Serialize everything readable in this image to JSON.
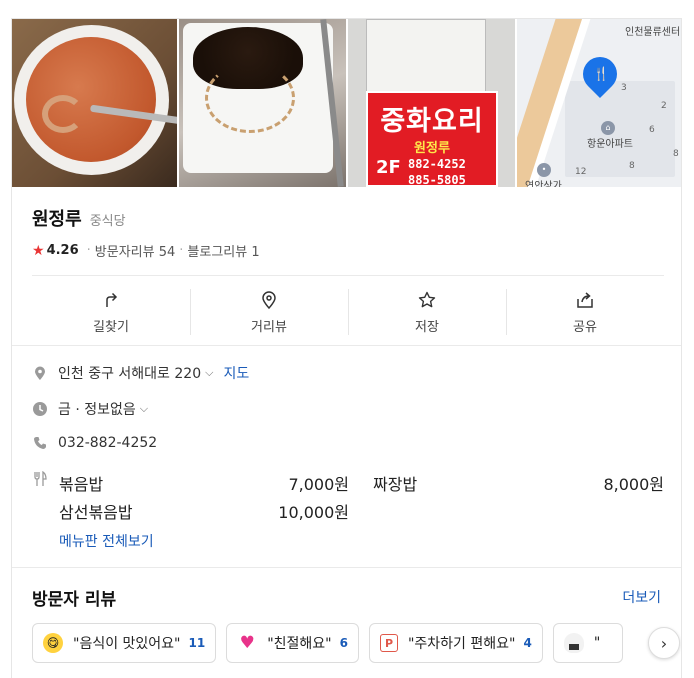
{
  "place": {
    "name": "원정루",
    "category": "중식당",
    "rating": "4.26",
    "visitor_reviews": "방문자리뷰 54",
    "blog_reviews": "블로그리뷰 1"
  },
  "photos": {
    "sign_title": "중화요리",
    "sign_sub": "원정루",
    "sign_floor": "2F",
    "sign_phone1": "882-4252",
    "sign_phone2": "885-5805",
    "map_label_top": "인천물류센터",
    "map_label_apt": "항운아파트",
    "map_label_bottom": "연안상가",
    "map_nums": [
      "3",
      "2",
      "6",
      "8",
      "12",
      "8"
    ]
  },
  "actions": [
    {
      "label": "길찾기",
      "icon": "directions-icon"
    },
    {
      "label": "거리뷰",
      "icon": "street-view-icon"
    },
    {
      "label": "저장",
      "icon": "star-icon"
    },
    {
      "label": "공유",
      "icon": "share-icon"
    }
  ],
  "info": {
    "address": "인천 중구 서해대로 220",
    "map_link": "지도",
    "hours": "금 · 정보없음",
    "phone": "032-882-4252"
  },
  "menu": {
    "items": [
      {
        "name": "볶음밥",
        "price": "7,000원"
      },
      {
        "name": "짜장밥",
        "price": "8,000원"
      },
      {
        "name": "삼선볶음밥",
        "price": "10,000원"
      }
    ],
    "view_all": "메뉴판 전체보기"
  },
  "reviews": {
    "title": "방문자 리뷰",
    "more": "더보기",
    "chips": [
      {
        "text": "\"음식이 맛있어요\"",
        "count": "11",
        "icon": "yum-face-icon"
      },
      {
        "text": "\"친절해요\"",
        "count": "6",
        "icon": "heart-icon"
      },
      {
        "text": "\"주차하기 편해요\"",
        "count": "4",
        "icon": "parking-icon"
      },
      {
        "text": "\"",
        "count": "",
        "icon": "rice-ball-icon"
      }
    ]
  },
  "colors": {
    "link": "#1a5bb8",
    "star": "#e93535",
    "sign_red": "#e21c24",
    "pin_blue": "#1a73e8"
  }
}
